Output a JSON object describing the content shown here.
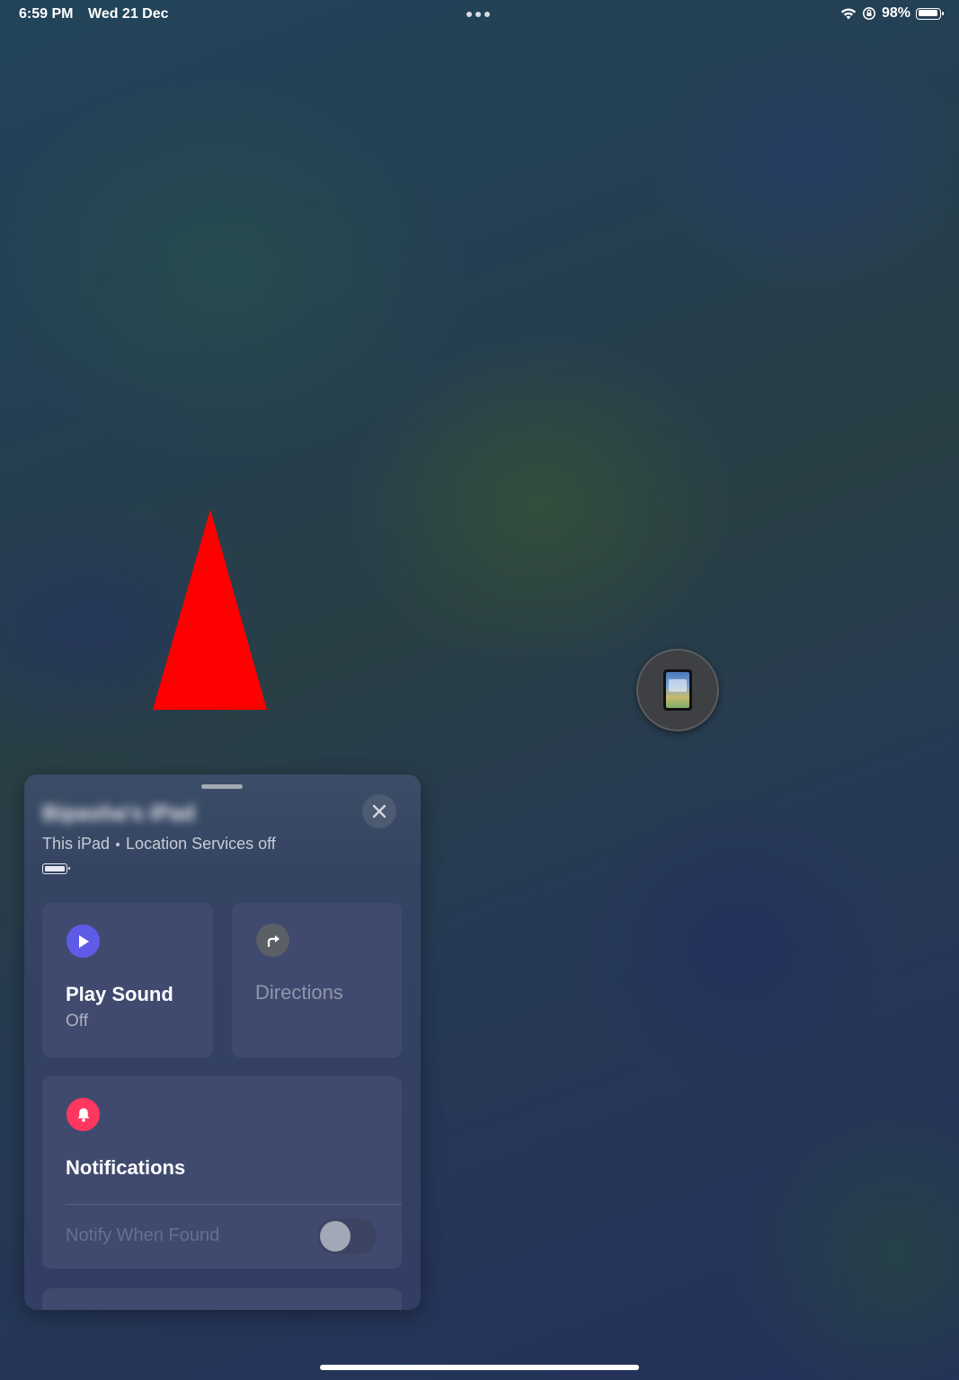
{
  "status_bar": {
    "time": "6:59 PM",
    "date": "Wed 21 Dec",
    "battery_percent": "98%",
    "icons": [
      "wifi-icon",
      "orientation-lock-icon",
      "battery-icon"
    ]
  },
  "map": {
    "marker_icon": "red-triangle-marker",
    "device_pin_icon": "ipad-icon"
  },
  "panel": {
    "device_name": "Bipasha's iPad",
    "subtitle_this": "This iPad",
    "subtitle_location": "Location Services off",
    "play_sound": {
      "title": "Play Sound",
      "status": "Off",
      "icon": "play-icon",
      "icon_color": "#5e5ce6"
    },
    "directions": {
      "title": "Directions",
      "icon": "directions-arrow-icon",
      "icon_color": "#5b5f66"
    },
    "notifications": {
      "title": "Notifications",
      "icon": "bell-icon",
      "icon_color": "#ff375f",
      "notify_label": "Notify When Found",
      "notify_on": false
    }
  }
}
